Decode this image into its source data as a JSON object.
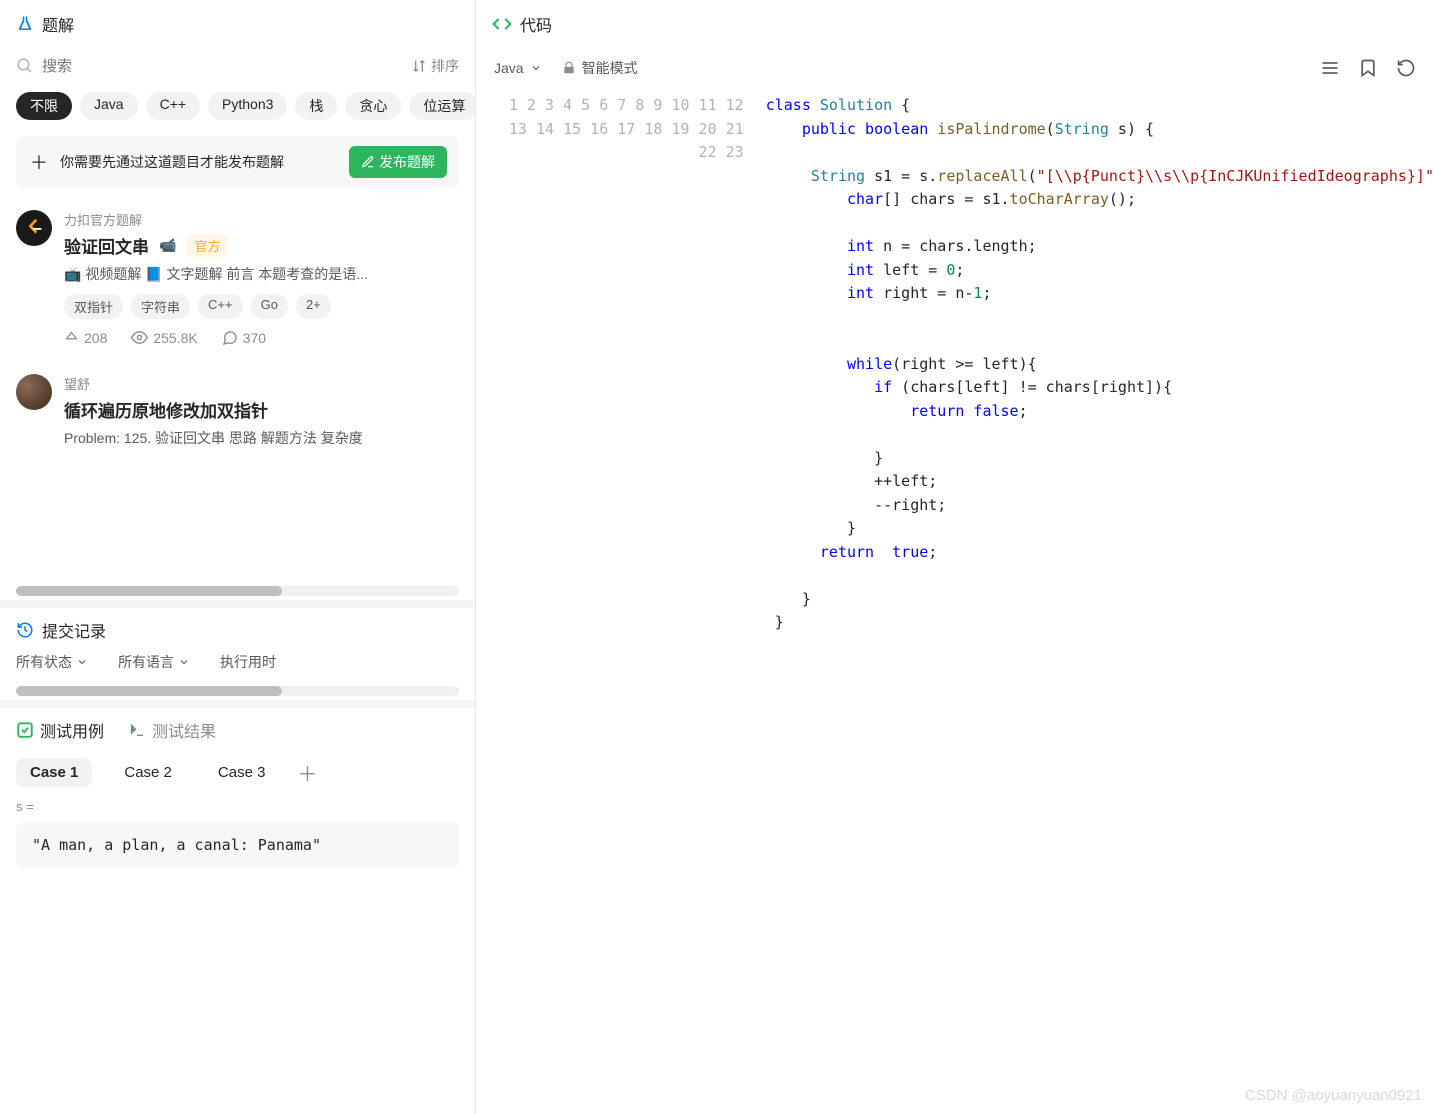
{
  "left": {
    "title": "题解",
    "search_placeholder": "搜索",
    "sort_label": "排序",
    "filters": [
      "不限",
      "Java",
      "C++",
      "Python3",
      "栈",
      "贪心",
      "位运算"
    ],
    "publish_hint": "你需要先通过这道题目才能发布题解",
    "publish_btn": "发布题解",
    "solutions": [
      {
        "author": "力扣官方题解",
        "title": "验证回文串",
        "has_video": true,
        "official_label": "官方",
        "preview": "📺 视频题解 📘 文字题解 前言 本题考查的是语...",
        "tags": [
          "双指针",
          "字符串",
          "C++",
          "Go",
          "2+"
        ],
        "upvotes": "208",
        "views": "255.8K",
        "comments": "370"
      },
      {
        "author": "望舒",
        "title": "循环遍历原地修改加双指针",
        "preview": "Problem: 125. 验证回文串 思路 解题方法 复杂度"
      }
    ]
  },
  "history": {
    "title": "提交记录",
    "status_filter": "所有状态",
    "lang_filter": "所有语言",
    "runtime_label": "执行用时"
  },
  "testcases": {
    "tab_cases": "测试用例",
    "tab_results": "测试结果",
    "cases": [
      "Case 1",
      "Case 2",
      "Case 3"
    ],
    "param_label": "s =",
    "param_value": "\"A man, a plan, a canal: Panama\""
  },
  "code_panel": {
    "title": "代码",
    "language": "Java",
    "mode": "智能模式",
    "code_lines": [
      "class Solution {",
      "    public boolean isPalindrome(String s) {",
      "",
      "     String s1 = s.replaceAll(\"[\\\\p{Punct}\\\\s\\\\p{InCJKUnifiedIdeographs}]\"",
      "         char[] chars = s1.toCharArray();",
      "",
      "         int n = chars.length;",
      "         int left = 0;",
      "         int right = n-1;",
      "",
      "",
      "         while(right >= left){",
      "            if (chars[left] != chars[right]){",
      "                return false;",
      "",
      "            }",
      "            ++left;",
      "            --right;",
      "         }",
      "      return  true;",
      "",
      "    }",
      " }"
    ]
  },
  "watermark": "CSDN @aoyuanyuan0921"
}
